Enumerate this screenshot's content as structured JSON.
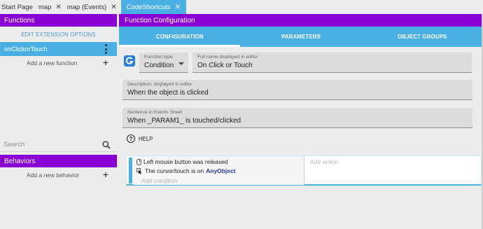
{
  "tabs": [
    {
      "label": "Start Page",
      "closable": false
    },
    {
      "label": "map",
      "closable": true
    },
    {
      "label": "map (Events)",
      "closable": true
    },
    {
      "label": "CodeShortcuts",
      "closable": true,
      "active": true
    }
  ],
  "close_glyph": "✕",
  "left_panel": {
    "functions_header": "Functions",
    "edit_extension_options": "EDIT EXTENSION OPTIONS",
    "selected_function": "onClickorTouch",
    "add_function": "Add a new function",
    "search_placeholder": "Search",
    "behaviors_header": "Behaviors",
    "add_behavior": "Add a new behavior"
  },
  "right_panel": {
    "header": "Function Configuration",
    "subtabs": [
      "CONFIGURATION",
      "PARAMETERS",
      "OBJECT GROUPS"
    ],
    "function_type_label": "Function type",
    "function_type_value": "Condition",
    "full_name_label": "Full name displayed in editor",
    "full_name_value": "On Click or Touch",
    "description_label": "Description, displayed in editor",
    "description_value": "When the object is clicked",
    "sentence_label": "Sentence in Events Sheet",
    "sentence_value": "When _PARAM1_ is touched/clicked",
    "help_label": "HELP"
  },
  "events": {
    "condition1": "Left mouse button was released",
    "condition2_prefix": "The cursor/touch is on",
    "condition2_object": "AnyObject",
    "add_condition": "Add condition",
    "add_action": "Add action"
  },
  "colors": {
    "purple": "#8a00d4",
    "blue": "#4ab0e4"
  },
  "icons": [
    "gdevelop-logo-icon",
    "kebab-menu-icon",
    "plus-icon",
    "search-icon",
    "help-icon",
    "mouse-icon",
    "cursor-icon",
    "close-icon"
  ]
}
